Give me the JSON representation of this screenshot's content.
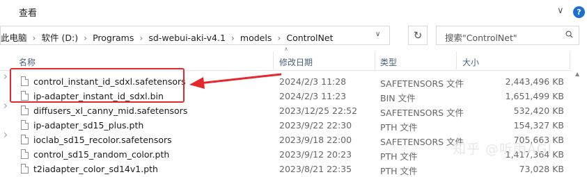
{
  "ribbon": {
    "tab_label": "查看",
    "collapse_glyph": "∨",
    "help_glyph": "?"
  },
  "address": {
    "crumbs": [
      "此电脑",
      "软件 (D:)",
      "Programs",
      "sd-webui-aki-v4.1",
      "models",
      "ControlNet"
    ],
    "separator": "›",
    "dropdown_glyph": "∨"
  },
  "refresh_glyph": "↻",
  "search": {
    "placeholder": "搜索\"ControlNet\""
  },
  "columns": {
    "name": "名称",
    "date": "修改日期",
    "type": "类型",
    "size": "大小"
  },
  "files": [
    {
      "name": "control_instant_id_sdxl.safetensors",
      "date": "2024/2/3 11:28",
      "type": "SAFETENSORS 文件",
      "size": "2,443,496 KB"
    },
    {
      "name": "ip-adapter_instant_id_sdxl.bin",
      "date": "2024/2/3 11:23",
      "type": "BIN 文件",
      "size": "1,651,499 KB"
    },
    {
      "name": "diffusers_xl_canny_mid.safetensors",
      "date": "2023/12/25 22:52",
      "type": "SAFETENSORS 文件",
      "size": "532,420 KB"
    },
    {
      "name": "ip-adapter_sd15_plus.pth",
      "date": "2023/9/22 22:30",
      "type": "PTH 文件",
      "size": "154,327 KB"
    },
    {
      "name": "ioclab_sd15_recolor.safetensors",
      "date": "2023/9/18 22:00",
      "type": "SAFETENSORS 文件",
      "size": "705,663 KB"
    },
    {
      "name": "control_sd15_random_color.pth",
      "date": "2023/9/12 20:23",
      "type": "PTH 文件",
      "size": "1,417,364 KB"
    },
    {
      "name": "t2iadapter_color_sd14v1.pth",
      "date": "2023/8/21 22:35",
      "type": "PTH 文件",
      "size": "73,028 KB"
    }
  ],
  "watermark": "知乎 @听雨AGI",
  "colors": {
    "accent": "#1f6fd1",
    "highlight": "#e4282b",
    "header_text": "#4c607a"
  },
  "icons": {
    "search": "search-icon",
    "file": "file-icon",
    "help": "help-icon",
    "refresh": "refresh-icon",
    "arrow": "red-arrow"
  }
}
